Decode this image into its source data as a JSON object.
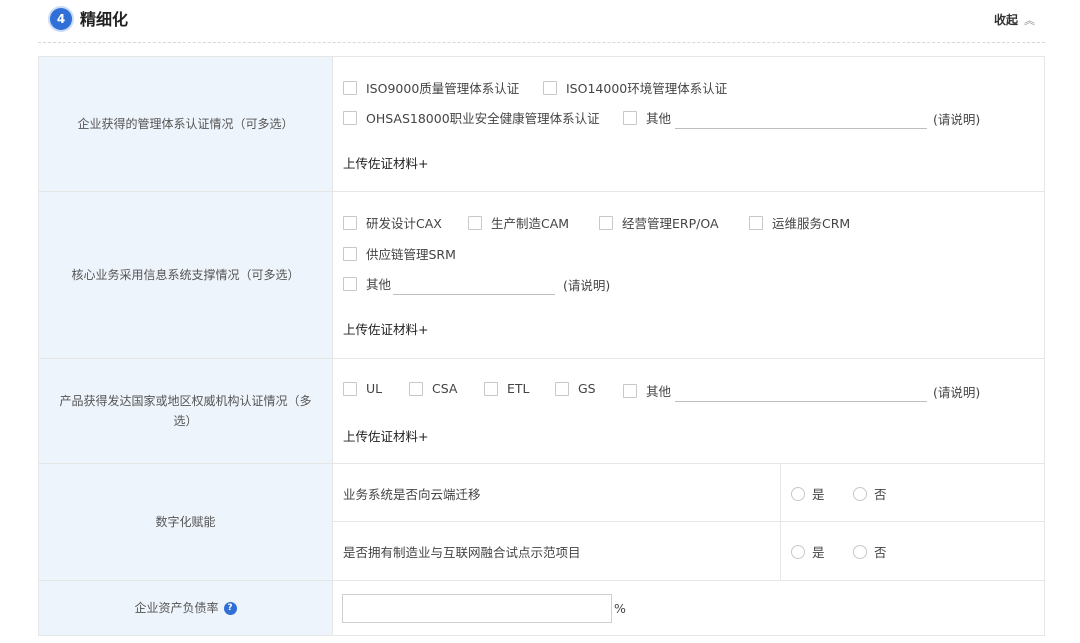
{
  "section": {
    "step_number": "4",
    "title": "精细化",
    "collapse_label": "收起"
  },
  "rows": {
    "mgmt_cert": {
      "label": "企业获得的管理体系认证情况（可多选）",
      "options": [
        "ISO9000质量管理体系认证",
        "ISO14000环境管理体系认证",
        "OHSAS18000职业安全健康管理体系认证",
        "其他"
      ],
      "other_note": "(请说明)",
      "upload_label": "上传佐证材料+"
    },
    "info_system": {
      "label": "核心业务采用信息系统支撑情况（可多选）",
      "options": [
        "研发设计CAX",
        "生产制造CAM",
        "经营管理ERP/OA",
        "运维服务CRM",
        "供应链管理SRM",
        "其他"
      ],
      "other_note": "(请说明)",
      "upload_label": "上传佐证材料+"
    },
    "product_cert": {
      "label": "产品获得发达国家或地区权威机构认证情况（多选）",
      "options": [
        "UL",
        "CSA",
        "ETL",
        "GS",
        "其他"
      ],
      "other_note": "(请说明)",
      "upload_label": "上传佐证材料+"
    },
    "digital": {
      "label": "数字化赋能",
      "questions": [
        {
          "text": "业务系统是否向云端迁移",
          "yes": "是",
          "no": "否"
        },
        {
          "text": "是否拥有制造业与互联网融合试点示范项目",
          "yes": "是",
          "no": "否"
        }
      ]
    },
    "debt_ratio": {
      "label": "企业资产负债率",
      "help_icon": "?",
      "value": "",
      "unit": "%"
    }
  }
}
